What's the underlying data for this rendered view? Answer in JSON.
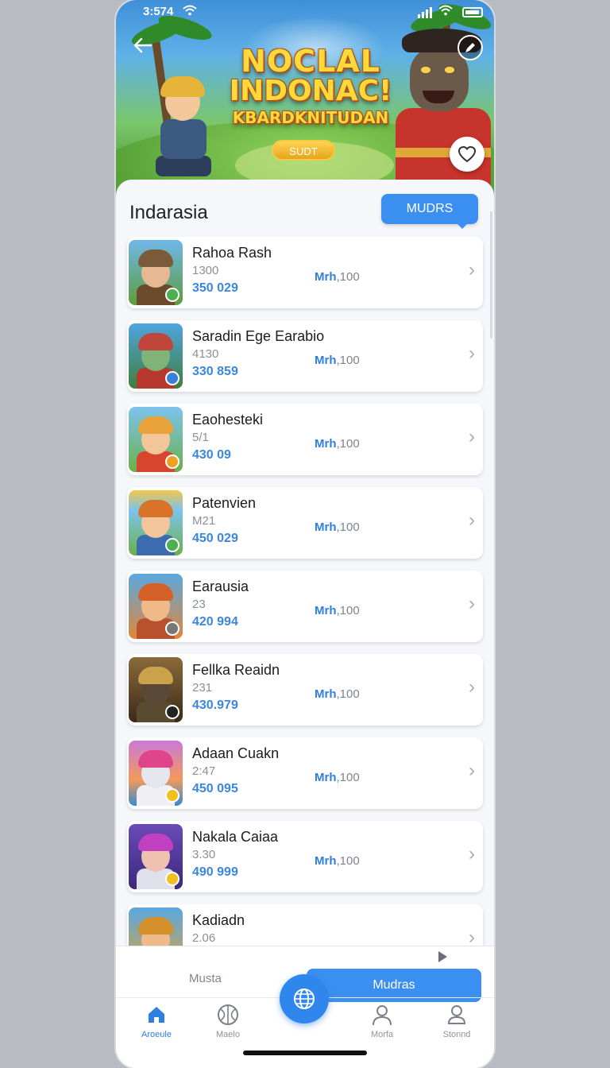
{
  "status_bar": {
    "time": "3:574"
  },
  "hero": {
    "title_line1": "NOCLAL",
    "title_line2": "INDONAC!",
    "title_line3": "KBARDKNITUDAN",
    "button_label": "SUDT"
  },
  "sheet": {
    "title": "Indarasia",
    "action_button": "MUDRS"
  },
  "items": [
    {
      "name": "Rahoa Rash",
      "sub": "1300",
      "price": "350 029",
      "mrh_a": "Mrh",
      "mrh_b": ",100"
    },
    {
      "name": "Saradin Ege Earabio",
      "sub": "4130",
      "price": "330 859",
      "mrh_a": "Mrh",
      "mrh_b": ",100"
    },
    {
      "name": "Eaohesteki",
      "sub": "5/1",
      "price": "430 09",
      "mrh_a": "Mrh",
      "mrh_b": ",100"
    },
    {
      "name": "Patenvien",
      "sub": "M21",
      "price": "450 029",
      "mrh_a": "Mrh",
      "mrh_b": ",100"
    },
    {
      "name": "Earausia",
      "sub": "23",
      "price": "420 994",
      "mrh_a": "Mrh",
      "mrh_b": ",100"
    },
    {
      "name": "Fellka Reaidn",
      "sub": "231",
      "price": "430.979",
      "mrh_a": "Mrh",
      "mrh_b": ",100"
    },
    {
      "name": "Adaan Cuakn",
      "sub": "2:47",
      "price": "450 095",
      "mrh_a": "Mrh",
      "mrh_b": ",100"
    },
    {
      "name": "Nakala Caiaa",
      "sub": "3.30",
      "price": "490 999",
      "mrh_a": "Mrh",
      "mrh_b": ",100"
    },
    {
      "name": "Kadiadn",
      "sub": "2.06",
      "price": "",
      "mrh_a": "",
      "mrh_b": ""
    }
  ],
  "bottom": {
    "left_label": "Musta",
    "action_button": "Mudras"
  },
  "nav": [
    {
      "label": "Aroeule",
      "icon": "home-icon",
      "active": true
    },
    {
      "label": "Maelo",
      "icon": "ball-icon",
      "active": false
    },
    {
      "label": "Morfa",
      "icon": "person-icon",
      "active": false
    },
    {
      "label": "Stonnd",
      "icon": "profile-icon",
      "active": false
    }
  ],
  "colors": {
    "accent": "#3b8ff0",
    "price": "#3b86e0",
    "title_gold": "#ffd83a"
  }
}
